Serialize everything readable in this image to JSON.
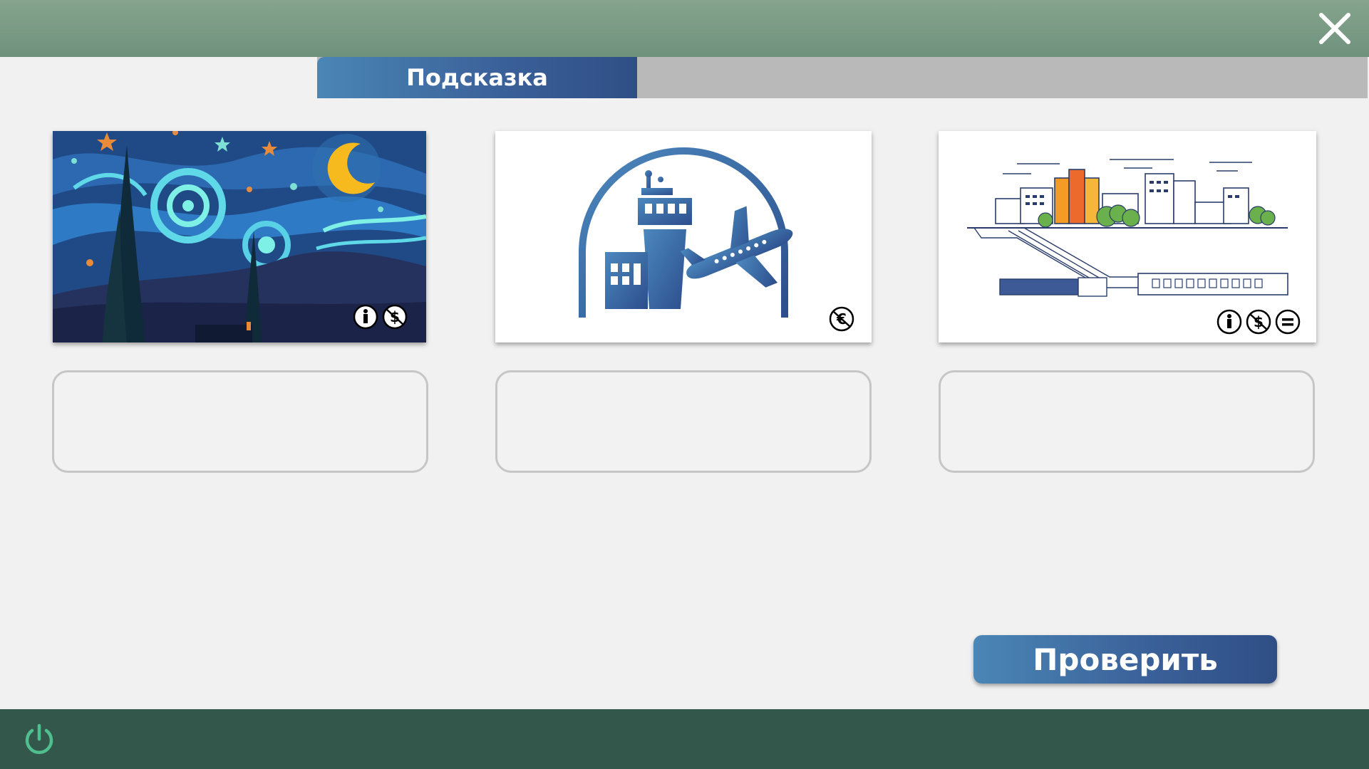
{
  "header": {
    "close_icon": "close-icon"
  },
  "tabs": {
    "active_label": "Подсказка"
  },
  "cards": [
    {
      "name": "starry-night-image",
      "license_icons": [
        "cc-by-icon",
        "cc-nc-icon"
      ]
    },
    {
      "name": "airport-image",
      "license_icons": [
        "cc-nc-icon"
      ]
    },
    {
      "name": "metro-city-image",
      "license_icons": [
        "cc-by-icon",
        "cc-nc-icon",
        "cc-nd-icon"
      ]
    }
  ],
  "answers": [
    {
      "value": ""
    },
    {
      "value": ""
    },
    {
      "value": ""
    }
  ],
  "actions": {
    "check_label": "Проверить"
  },
  "footer": {
    "power_icon": "power-icon"
  },
  "colors": {
    "accent": "#3a5f98",
    "top_bar": "#7a9a84",
    "bottom_bar": "#33574a",
    "power": "#4fbf8f"
  }
}
